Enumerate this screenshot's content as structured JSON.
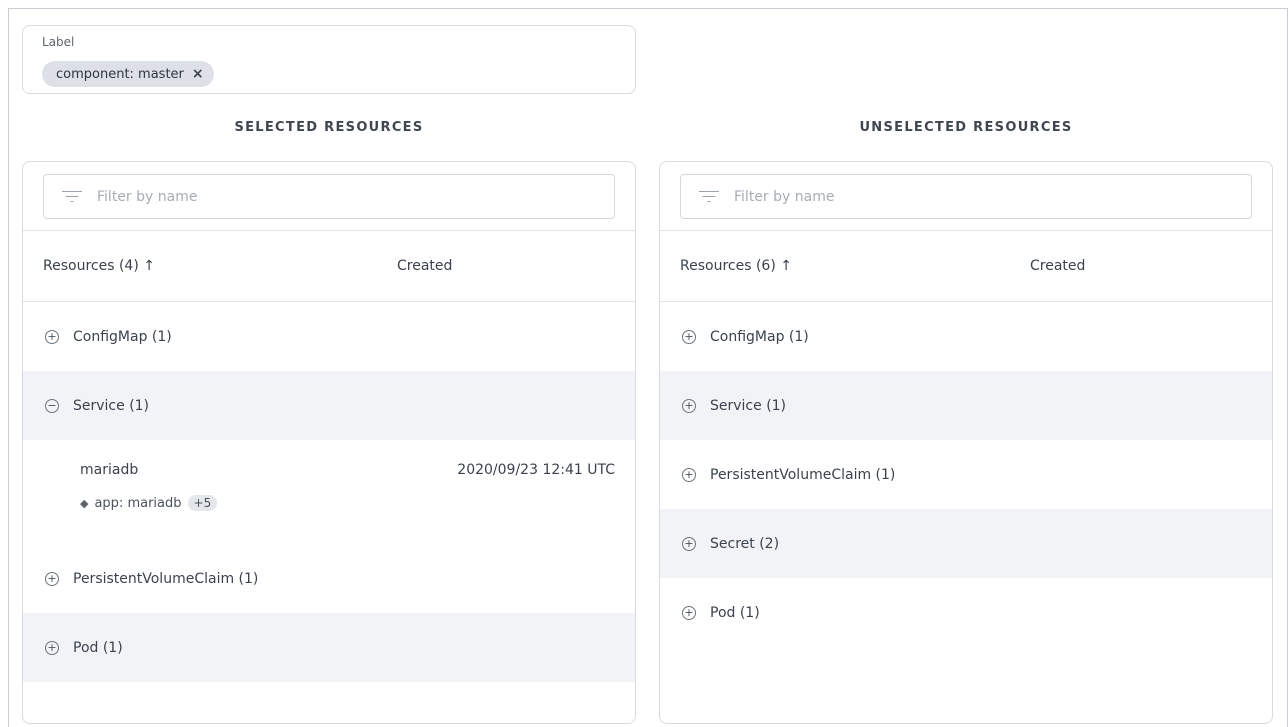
{
  "label_filter": {
    "caption": "Label",
    "chip_text": "component: master",
    "chip_remove": "×"
  },
  "selected": {
    "title": "SELECTED RESOURCES",
    "filter_placeholder": "Filter by name",
    "header": {
      "resources": "Resources (4) ↑",
      "created": "Created"
    },
    "rows": [
      {
        "toggle": "+",
        "label": "ConfigMap (1)"
      },
      {
        "toggle": "−",
        "label": "Service (1)"
      },
      {
        "toggle": "+",
        "label": "PersistentVolumeClaim (1)"
      },
      {
        "toggle": "+",
        "label": "Pod (1)"
      }
    ],
    "expanded_child": {
      "name": "mariadb",
      "created": "2020/09/23 12:41 UTC",
      "label": "app: mariadb",
      "more": "+5"
    }
  },
  "unselected": {
    "title": "UNSELECTED RESOURCES",
    "filter_placeholder": "Filter by name",
    "header": {
      "resources": "Resources (6) ↑",
      "created": "Created"
    },
    "rows": [
      {
        "toggle": "+",
        "label": "ConfigMap (1)"
      },
      {
        "toggle": "+",
        "label": "Service (1)"
      },
      {
        "toggle": "+",
        "label": "PersistentVolumeClaim (1)"
      },
      {
        "toggle": "+",
        "label": "Secret (2)"
      },
      {
        "toggle": "+",
        "label": "Pod (1)"
      }
    ]
  },
  "icons": {
    "filter": "filter-icon",
    "tag": "tag-icon",
    "expand": "plus-circle-icon",
    "collapse": "minus-circle-icon",
    "sort": "arrow-up-icon",
    "remove": "close-icon"
  }
}
